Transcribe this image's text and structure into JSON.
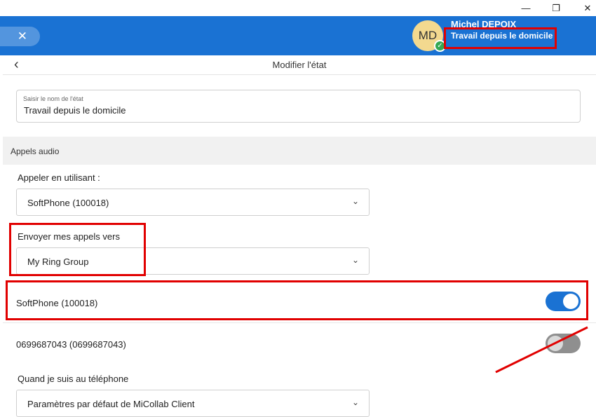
{
  "window": {
    "minimize_glyph": "—",
    "restore_glyph": "❐",
    "close_glyph": "✕"
  },
  "appbar": {
    "close_icon": "✕",
    "avatar_initials": "MD",
    "user_name": "Michel DEPOIX",
    "user_status": "Travail depuis le domicile",
    "status_check": "✓"
  },
  "page": {
    "back_icon": "‹",
    "title": "Modifier l'état"
  },
  "name_field": {
    "label": "Saisir le nom de l'état",
    "value": "Travail depuis le domicile"
  },
  "section": {
    "title": "Appels audio"
  },
  "call_using": {
    "label": "Appeler en utilisant :",
    "selected": "SoftPhone (100018)",
    "chevron": "⌄"
  },
  "send_calls_to": {
    "label": "Envoyer mes appels vers",
    "selected": "My Ring Group",
    "chevron": "⌄"
  },
  "devices": [
    {
      "label": "SoftPhone (100018)",
      "enabled": true
    },
    {
      "label": "0699687043 (0699687043)",
      "enabled": false
    }
  ],
  "on_phone": {
    "label": "Quand je suis au téléphone",
    "selected": "Paramètres par défaut de MiCollab Client",
    "chevron": "⌄"
  },
  "colors": {
    "accent": "#1a72d3",
    "highlight": "#e10000",
    "toggle_off": "#8f8f8f"
  }
}
